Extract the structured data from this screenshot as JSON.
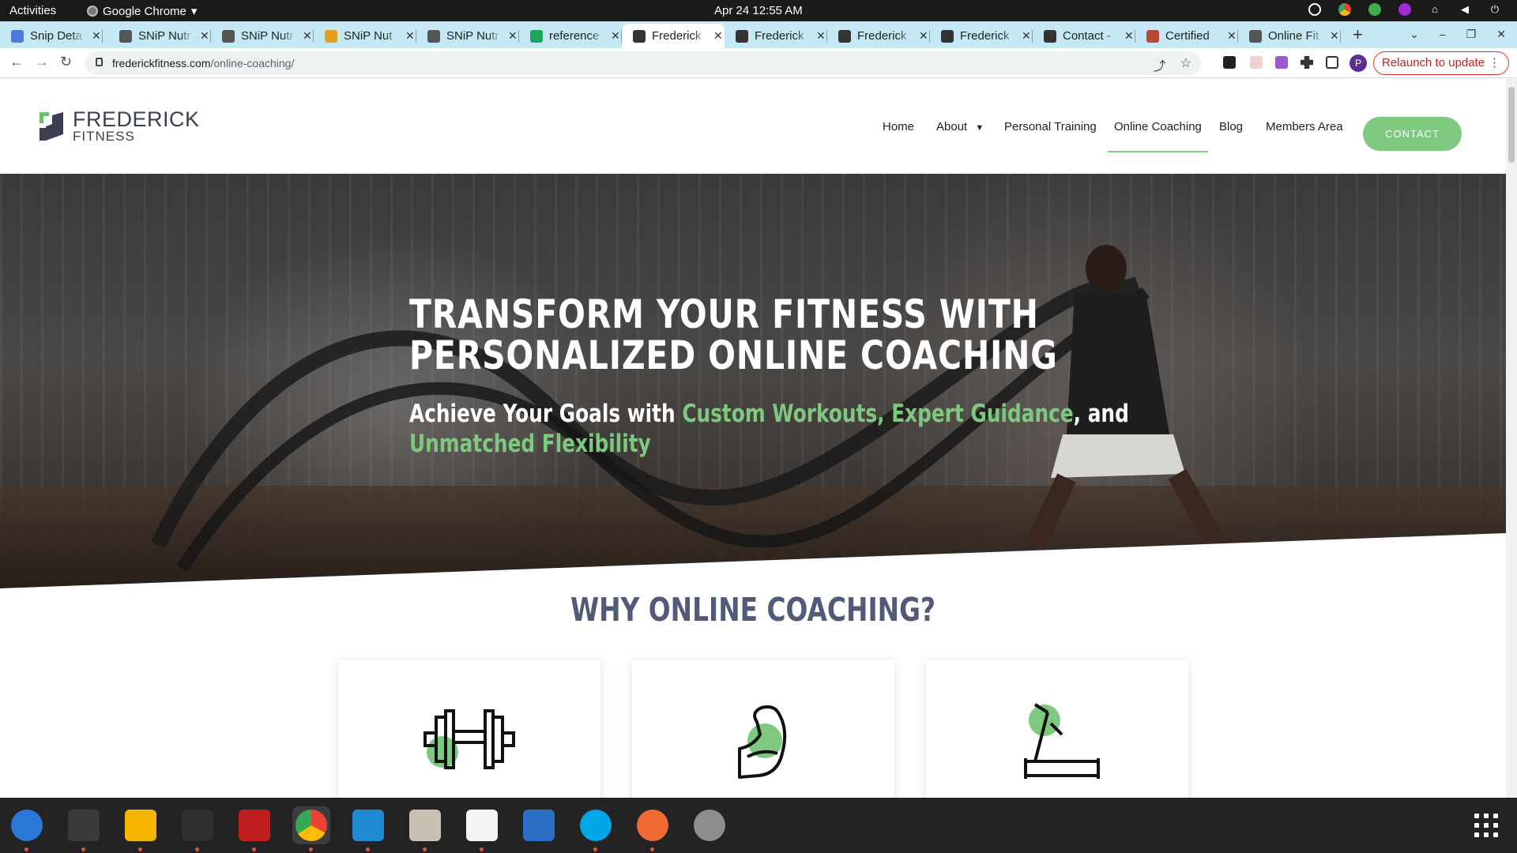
{
  "topbar": {
    "activities": "Activities",
    "app_name": "Google Chrome",
    "clock": "Apr 24  12:55 AM"
  },
  "tabs": [
    {
      "title": "Snip Deta",
      "favicon": "docs-icon",
      "color": "#4a7ce0"
    },
    {
      "title": "SNiP Nutr",
      "favicon": "snip-icon",
      "color": "#555555"
    },
    {
      "title": "SNiP Nutr",
      "favicon": "snip-icon",
      "color": "#555555"
    },
    {
      "title": "SNiP Nut",
      "favicon": "chrome-icon",
      "color": "#e0a020"
    },
    {
      "title": "SNiP Nutr",
      "favicon": "snip-icon",
      "color": "#555555"
    },
    {
      "title": "reference",
      "favicon": "sheets-icon",
      "color": "#1fa463"
    },
    {
      "title": "Frederick",
      "favicon": "frederick-icon",
      "color": "#333333"
    },
    {
      "title": "Frederick",
      "favicon": "frederick-icon",
      "color": "#333333"
    },
    {
      "title": "Frederick",
      "favicon": "frederick-icon",
      "color": "#333333"
    },
    {
      "title": "Frederick",
      "favicon": "frederick-icon",
      "color": "#333333"
    },
    {
      "title": "Contact -",
      "favicon": "frederick-icon",
      "color": "#333333"
    },
    {
      "title": "Certified",
      "favicon": "cert-icon",
      "color": "#b54a3a"
    },
    {
      "title": "Online Fit",
      "favicon": "globe-icon",
      "color": "#555555"
    }
  ],
  "active_tab_index": 6,
  "omnibox": {
    "domain": "frederickfitness.com",
    "path": "/online-coaching/"
  },
  "relaunch_label": "Relaunch to update",
  "profile_initial": "P",
  "site": {
    "logo": {
      "line1": "FREDERICK",
      "line2": "FITNESS"
    },
    "menu": [
      {
        "label": "Home"
      },
      {
        "label": "About"
      },
      {
        "label": "Personal Training"
      },
      {
        "label": "Online Coaching"
      },
      {
        "label": "Blog"
      },
      {
        "label": "Members Area"
      }
    ],
    "contact_button": "CONTACT",
    "hero": {
      "title_line1": "TRANSFORM YOUR FITNESS WITH",
      "title_line2": "PERSONALIZED ONLINE COACHING",
      "sub_a": "Achieve Your Goals with ",
      "sub_b": "Custom Workouts, Expert Guidance",
      "sub_c": ", and",
      "sub_d": "Unmatched Flexibility"
    },
    "why_heading": "WHY ONLINE COACHING?",
    "cards": [
      {
        "icon": "dumbbell-icon"
      },
      {
        "icon": "flexed-arm-icon"
      },
      {
        "icon": "treadmill-icon"
      }
    ]
  },
  "colors": {
    "accent_green": "#7ec87f",
    "heading_slate": "#525a78",
    "tab_strip": "#c5e9f4"
  },
  "dock": [
    {
      "name": "thunderbird-icon",
      "color": "#2a78d6",
      "running": true
    },
    {
      "name": "terminal-icon",
      "color": "#3a3a3a",
      "running": true
    },
    {
      "name": "calculator-icon",
      "color": "#f5b400",
      "running": true
    },
    {
      "name": "system-monitor-icon",
      "color": "#2f2f2f",
      "running": true
    },
    {
      "name": "filezilla-icon",
      "color": "#bf1e1e",
      "running": true
    },
    {
      "name": "chrome-icon",
      "color": "#e8e8e8",
      "running": true
    },
    {
      "name": "vscode-icon",
      "color": "#1f8ad2",
      "running": true
    },
    {
      "name": "files-icon",
      "color": "#c9c1b3",
      "running": true
    },
    {
      "name": "text-editor-icon",
      "color": "#f4f4f4",
      "running": true
    },
    {
      "name": "writer-icon",
      "color": "#2b6cc4",
      "running": false
    },
    {
      "name": "skype-icon",
      "color": "#00a6e6",
      "running": true
    },
    {
      "name": "postman-icon",
      "color": "#f06a35",
      "running": true
    },
    {
      "name": "disk-icon",
      "color": "#8d8d8d",
      "running": false
    }
  ]
}
